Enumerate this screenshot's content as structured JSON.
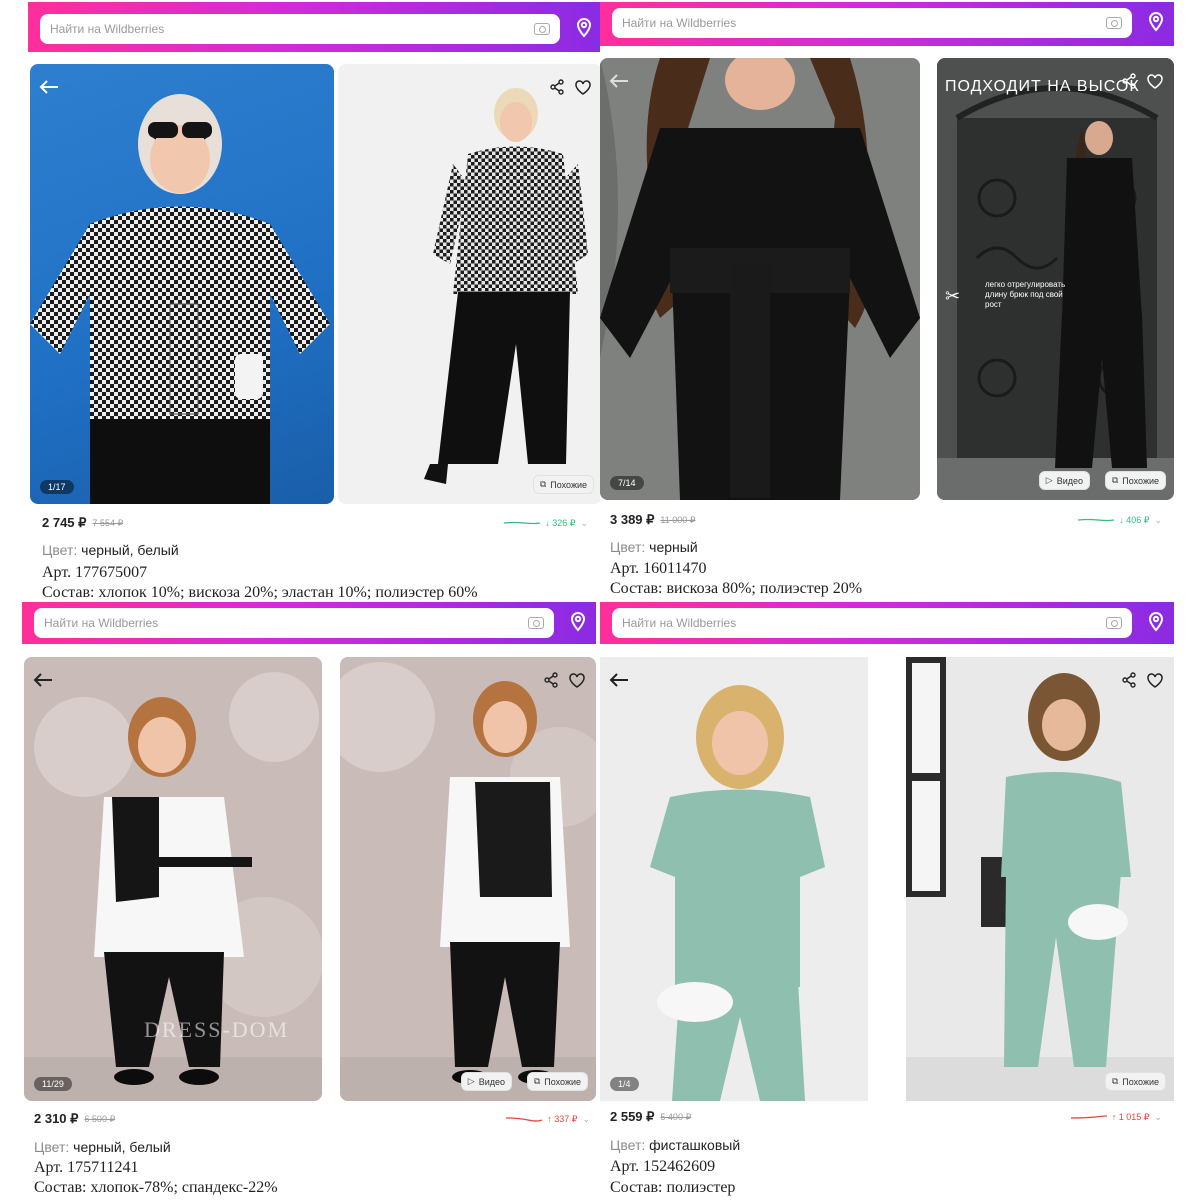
{
  "search_placeholder": "Найти на Wildberries",
  "ui": {
    "video_label": "Видео",
    "similar_label": "Похожие",
    "color_label": "Цвет:"
  },
  "products": [
    {
      "photo_counter": "1/17",
      "price": "2 745 ₽",
      "old_price": "7 554 ₽",
      "trend": "↓ 326 ₽",
      "color": "черный, белый",
      "article": "Арт. 177675007",
      "composition": "Состав: хлопок 10%; вискоза 20%; эластан 10%; полиэстер 60%",
      "trend_color": "#2fbf7a"
    },
    {
      "photo_counter": "7/14",
      "price": "3 389 ₽",
      "old_price": "11 000 ₽",
      "trend": "↓ 406 ₽",
      "color": "черный",
      "article": "Арт. 16011470",
      "composition": "Состав: вискоза 80%; полиэстер 20%",
      "promo_title": "ПОДХОДИТ НА ВЫСОК",
      "promo_note": "легко отрегулировать длину брюк под свой рост",
      "trend_color": "#2fbf7a"
    },
    {
      "photo_counter": "11/29",
      "price": "2 310 ₽",
      "old_price": "6 500 ₽",
      "trend": "↑ 337 ₽",
      "color": "черный, белый",
      "article": "Арт. 175711241",
      "composition": "Состав: хлопок-78%; спандекс-22%",
      "brand_watermark": "DRESS-DOM",
      "trend_color": "#e7453b"
    },
    {
      "photo_counter": "1/4",
      "price": "2 559 ₽",
      "old_price": "5 400 ₽",
      "trend": "↑ 1 015 ₽",
      "color": "фисташковый",
      "article": "Арт. 152462609",
      "composition": "Состав: полиэстер",
      "trend_color": "#e7453b"
    }
  ],
  "icons": [
    "camera-icon",
    "location-pin-icon",
    "back-arrow-icon",
    "share-icon",
    "heart-icon",
    "play-icon",
    "similar-icon"
  ]
}
